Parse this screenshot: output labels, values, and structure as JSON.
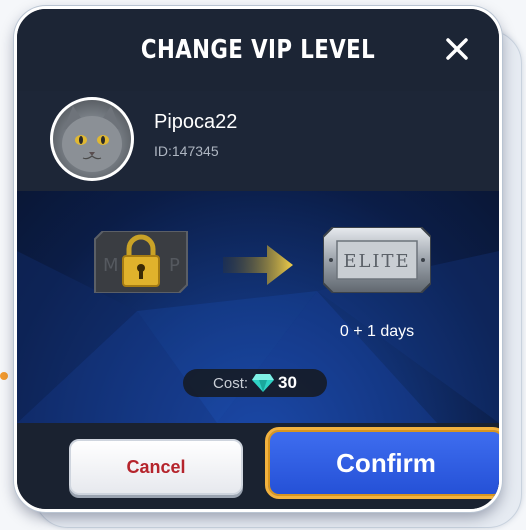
{
  "dialog": {
    "title": "CHANGE VIP LEVEL",
    "close_icon": "close-icon"
  },
  "user": {
    "name": "Pipoca22",
    "id_text": "ID:147345",
    "avatar_icon": "cat-avatar"
  },
  "upgrade": {
    "from_icon": "locked-vip-card-icon",
    "arrow_icon": "arrow-right-icon",
    "to_label": "ELITE",
    "to_icon": "elite-card-icon",
    "days_text": "0 + 1 days"
  },
  "cost": {
    "label": "Cost:",
    "icon": "diamond-icon",
    "value": "30"
  },
  "buttons": {
    "cancel_label": "Cancel",
    "confirm_label": "Confirm"
  },
  "colors": {
    "confirm_bg": "#2f5fe6",
    "confirm_border": "#f3b23e",
    "cancel_text": "#b5242c",
    "panel_bg": "#1b2332",
    "diamond": "#2fd3c6"
  }
}
